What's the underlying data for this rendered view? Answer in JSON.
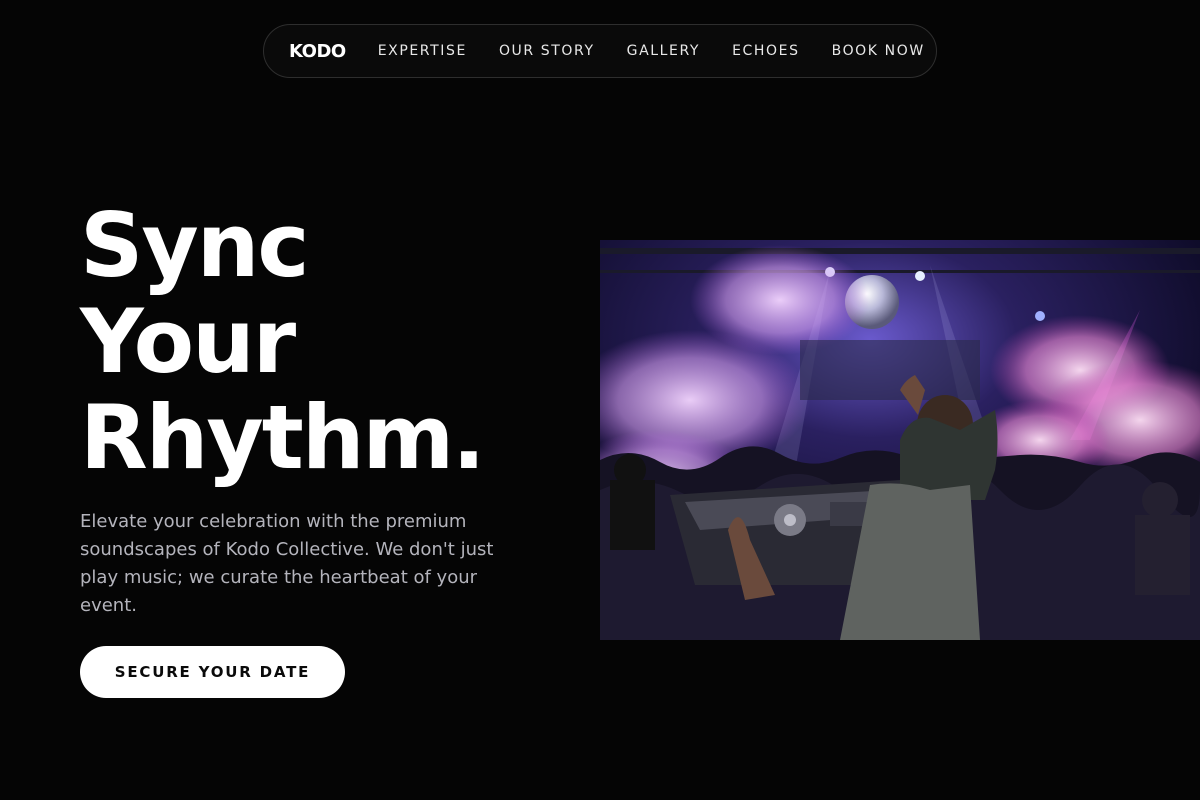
{
  "nav": {
    "logo": "KODO",
    "links": [
      "EXPERTISE",
      "OUR STORY",
      "GALLERY",
      "ECHOES",
      "BOOK NOW"
    ]
  },
  "hero": {
    "title_lines": [
      "Sync",
      "Your",
      "Rhythm."
    ],
    "description": "Elevate your celebration with the premium soundscapes of Kodo Collective. We don't just play music; we curate the heartbeat of your event.",
    "cta_label": "SECURE YOUR DATE"
  },
  "image": {
    "subject": "DJ performing at club with crowd, smoke cannons and disco ball"
  },
  "colors": {
    "background": "#050505",
    "text": "#ffffff",
    "muted_text": "#b4b4bc",
    "nav_border": "#2e2e2e",
    "cta_bg": "#ffffff",
    "cta_text": "#0a0a0a"
  }
}
